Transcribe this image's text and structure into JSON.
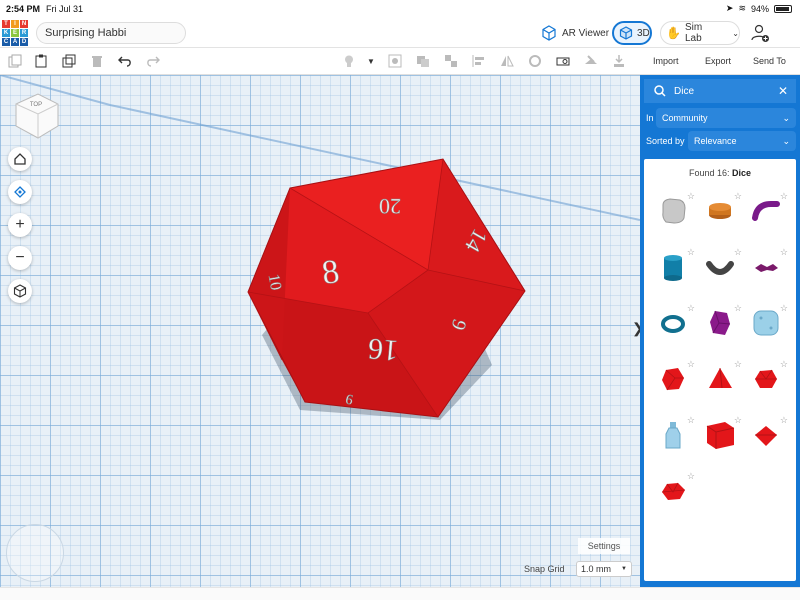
{
  "status": {
    "time": "2:54 PM",
    "date": "Fri Jul 31",
    "battery": "94%"
  },
  "header": {
    "logo_letters": [
      "T",
      "I",
      "N",
      "K",
      "E",
      "R",
      "C",
      "A",
      "D"
    ],
    "project_name": "Surprising Habbi",
    "ar_viewer": "AR Viewer",
    "view_3d": "3D",
    "sim_lab": "Sim Lab"
  },
  "toolbar": {
    "import": "Import",
    "export": "Export",
    "send_to": "Send To"
  },
  "workplane": {
    "die_faces": [
      "20",
      "8",
      "14",
      "16",
      "6",
      "10",
      "9"
    ],
    "settings": "Settings",
    "snap_grid_label": "Snap Grid",
    "snap_grid_value": "1.0 mm",
    "viewcube_label": "TOP"
  },
  "panel": {
    "search_value": "Dice",
    "in_label": "In",
    "in_value": "Community",
    "sorted_label": "Sorted by",
    "sorted_value": "Relevance",
    "found_prefix": "Found 16:",
    "found_query": "Dice",
    "shapes": [
      "gray-rounded-cube",
      "orange-cylinder",
      "purple-curved-tube",
      "blue-cylinder",
      "dark-gray-torus-half",
      "purple-small-dice",
      "teal-ring",
      "purple-hexagonal-prism",
      "light-blue-rounded-cube",
      "red-icosahedron",
      "red-tetrahedron",
      "red-octahedron-small",
      "light-blue-bottle",
      "red-cube",
      "red-diamond",
      "red-pentagonal-shape"
    ]
  },
  "colors": {
    "accent": "#1477d4",
    "die_red": "#e8191a",
    "grid": "#e8f0f7"
  }
}
